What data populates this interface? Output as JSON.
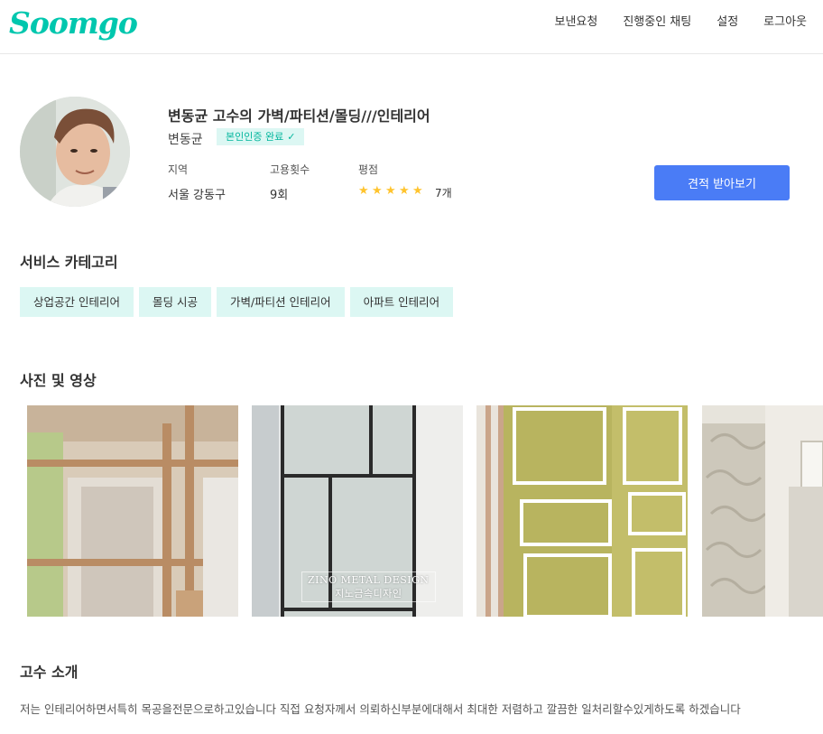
{
  "brand": {
    "logo_text": "Soomgo",
    "color": "#00c7ae"
  },
  "nav": {
    "items": [
      {
        "label": "보낸요청"
      },
      {
        "label": "진행중인 채팅"
      },
      {
        "label": "설정"
      },
      {
        "label": "로그아웃"
      }
    ]
  },
  "profile": {
    "title": "변동균 고수의 가벽/파티션/몰딩///인테리어",
    "name": "변동균",
    "verified_label": "본인인증 완료",
    "stats": {
      "region_label": "지역",
      "region_value": "서울 강동구",
      "hires_label": "고용횟수",
      "hires_value": "9회",
      "rating_label": "평점",
      "rating_stars": 5,
      "review_count": "7개"
    },
    "cta_label": "견적 받아보기",
    "cta_color": "#4a7cf6"
  },
  "categories": {
    "title": "서비스 카테고리",
    "items": [
      "상업공간 인테리어",
      "몰딩 시공",
      "가벽/파티션 인테리어",
      "아파트 인테리어"
    ]
  },
  "media": {
    "title": "사진 및 영상",
    "watermark_line1": "ZINO METAL DESIGN",
    "watermark_line2": "지노금속디자인"
  },
  "intro": {
    "title": "고수 소개",
    "text": "저는 인테리어하면서특히 목공을전문으로하고있습니다 직접 요청자께서 의뢰하신부분에대해서 최대한 저렴하고 깔끔한 일처리할수있게하도록 하겠습니다"
  }
}
